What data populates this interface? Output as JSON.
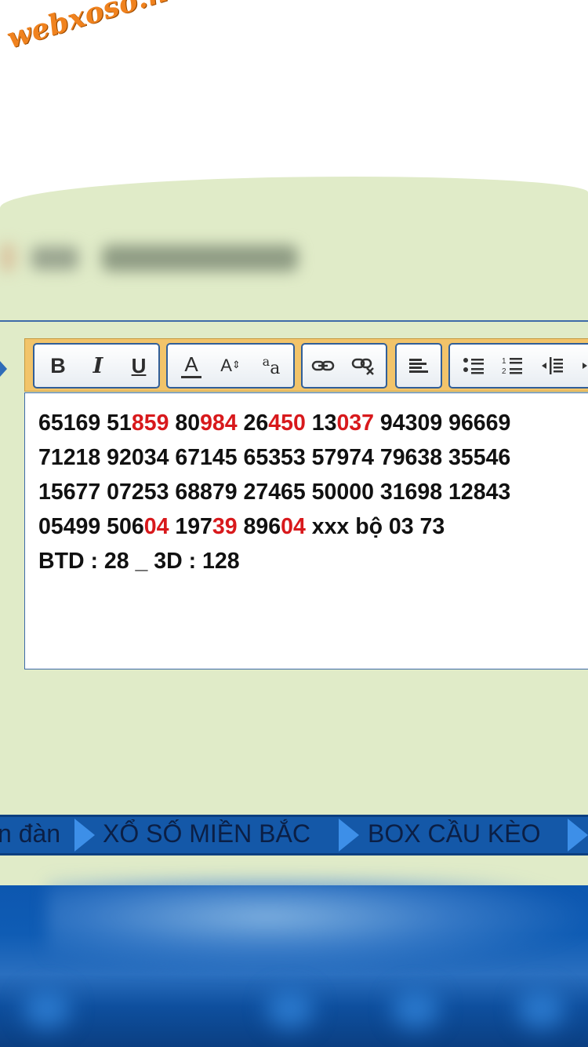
{
  "logo": {
    "text": "webxoso.net"
  },
  "toolbar": {
    "groups": [
      {
        "buttons": [
          "bold-icon",
          "italic-icon",
          "underline-icon"
        ]
      },
      {
        "buttons": [
          "text-color-icon",
          "font-size-icon",
          "font-case-icon"
        ]
      },
      {
        "buttons": [
          "link-icon",
          "unlink-icon"
        ]
      },
      {
        "buttons": [
          "align-left-icon"
        ]
      },
      {
        "buttons": [
          "bullet-list-icon",
          "numbered-list-icon",
          "outdent-icon",
          "indent-icon"
        ]
      }
    ],
    "labels": {
      "bold": "B",
      "italic": "I",
      "underline": "U",
      "color": "A",
      "size": "A",
      "case_a": "a",
      "case_b": "a"
    }
  },
  "editor": {
    "highlight_color": "#d8191c",
    "lines": [
      [
        {
          "t": "65169 51"
        },
        {
          "t": "859",
          "red": true
        },
        {
          "t": " 80"
        },
        {
          "t": "984",
          "red": true
        },
        {
          "t": " 26"
        },
        {
          "t": "450",
          "red": true
        },
        {
          "t": " 13"
        },
        {
          "t": "037",
          "red": true
        },
        {
          "t": " 94309 96669"
        }
      ],
      [
        {
          "t": "71218 92034 67145 65353 57974 79638 35546"
        }
      ],
      [
        {
          "t": "15677 07253 68879 27465 50000 31698 12843"
        }
      ],
      [
        {
          "t": "05499 506"
        },
        {
          "t": "04",
          "red": true
        },
        {
          "t": " 197"
        },
        {
          "t": "39",
          "red": true
        },
        {
          "t": " 896"
        },
        {
          "t": "04",
          "red": true
        },
        {
          "t": " xxx bộ 03 73"
        }
      ],
      [
        {
          "t": "BTD : 28 _ 3D : 128"
        }
      ]
    ]
  },
  "nav": {
    "items": [
      "n đàn",
      "XỔ SỐ MIỀN BẮC",
      "BOX CẦU KÈO"
    ]
  },
  "colors": {
    "page_green": "#e0ebc8",
    "toolbar_orange": "#f2c46a",
    "nav_blue": "#1458a8",
    "nav_arrow": "#3d8fe8",
    "accent_blue": "#3e6ba8"
  }
}
